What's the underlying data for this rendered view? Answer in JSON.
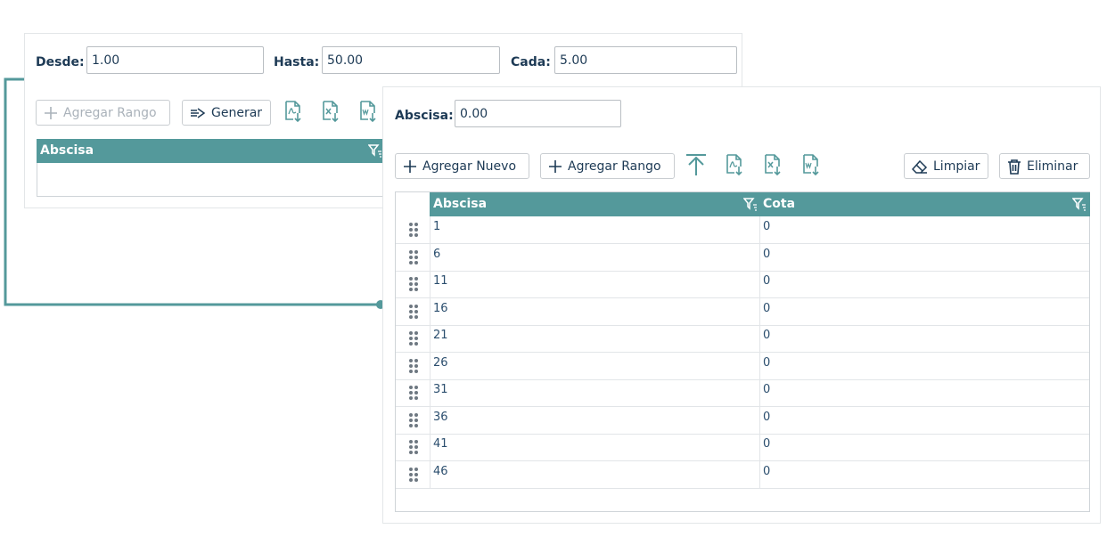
{
  "range_panel": {
    "desde_label": "Desde:",
    "desde_value": "1.00",
    "hasta_label": "Hasta:",
    "hasta_value": "50.00",
    "cada_label": "Cada:",
    "cada_value": "5.00",
    "add_range_label": "Agregar Rango",
    "generate_label": "Generar",
    "table_header": "Abscisa"
  },
  "main_panel": {
    "abscisa_label": "Abscisa:",
    "abscisa_value": "0.00",
    "add_new_label": "Agregar Nuevo",
    "add_range_label": "Agregar Rango",
    "clear_label": "Limpiar",
    "delete_label": "Eliminar",
    "columns": [
      "Abscisa",
      "Cota"
    ],
    "rows": [
      [
        "1",
        "0"
      ],
      [
        "6",
        "0"
      ],
      [
        "11",
        "0"
      ],
      [
        "16",
        "0"
      ],
      [
        "21",
        "0"
      ],
      [
        "26",
        "0"
      ],
      [
        "31",
        "0"
      ],
      [
        "36",
        "0"
      ],
      [
        "41",
        "0"
      ],
      [
        "46",
        "0"
      ]
    ]
  },
  "colors": {
    "accent": "#54999b",
    "text": "#1d3a55"
  },
  "icons": [
    "plus-icon",
    "generate-icon",
    "export-pdf-icon",
    "export-excel-icon",
    "export-word-icon",
    "upload-icon",
    "eraser-icon",
    "trash-icon",
    "filter-icon",
    "drag-handle-icon"
  ]
}
